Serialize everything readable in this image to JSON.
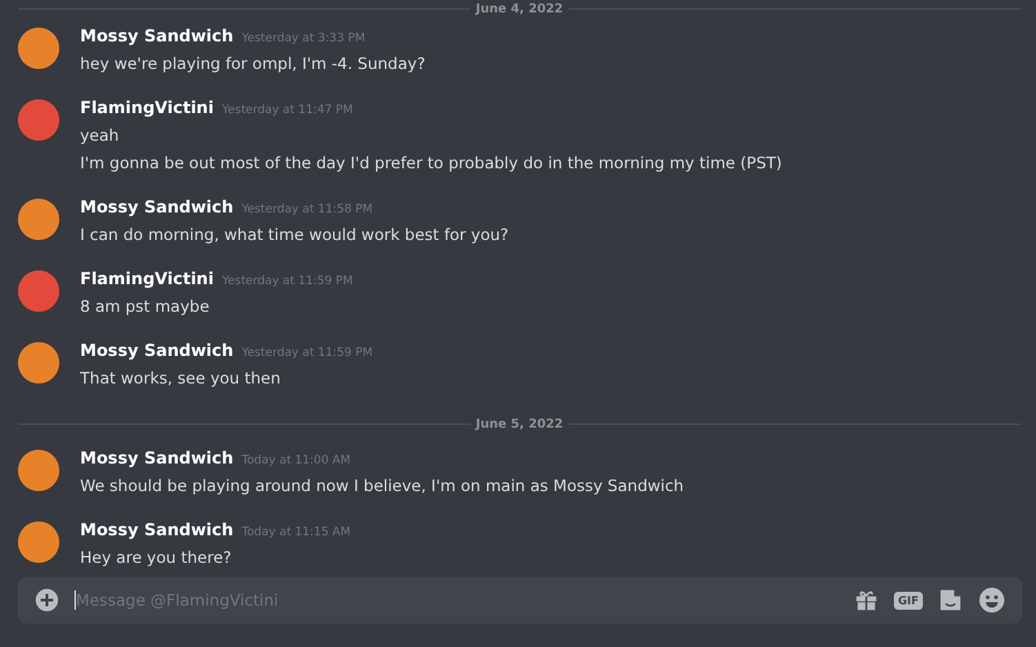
{
  "dividers": [
    "June 4, 2022",
    "June 5, 2022"
  ],
  "days": [
    {
      "groups": [
        {
          "author": "Mossy Sandwich",
          "time": "Yesterday at 3:33 PM",
          "color": "#e8822a",
          "messages": [
            "hey we're playing for ompl, I'm -4. Sunday?"
          ]
        },
        {
          "author": "FlamingVictini",
          "time": "Yesterday at 11:47 PM",
          "color": "#e44a3c",
          "messages": [
            "yeah",
            "I'm gonna be out most of the day I'd prefer to probably do in the morning my time (PST)"
          ]
        },
        {
          "author": "Mossy Sandwich",
          "time": "Yesterday at 11:58 PM",
          "color": "#e8822a",
          "messages": [
            "I can do morning, what time would work best for you?"
          ]
        },
        {
          "author": "FlamingVictini",
          "time": "Yesterday at 11:59 PM",
          "color": "#e44a3c",
          "messages": [
            "8 am pst maybe"
          ]
        },
        {
          "author": "Mossy Sandwich",
          "time": "Yesterday at 11:59 PM",
          "color": "#e8822a",
          "messages": [
            "That works, see you then"
          ]
        }
      ]
    },
    {
      "groups": [
        {
          "author": "Mossy Sandwich",
          "time": "Today at 11:00 AM",
          "color": "#e8822a",
          "messages": [
            "We should be playing around now I believe, I'm on main as Mossy Sandwich"
          ]
        },
        {
          "author": "Mossy Sandwich",
          "time": "Today at 11:15 AM",
          "color": "#e8822a",
          "messages": [
            "Hey are you there?"
          ]
        }
      ]
    }
  ],
  "composer": {
    "placeholder": "Message @FlamingVictini",
    "gif_label": "GIF"
  }
}
